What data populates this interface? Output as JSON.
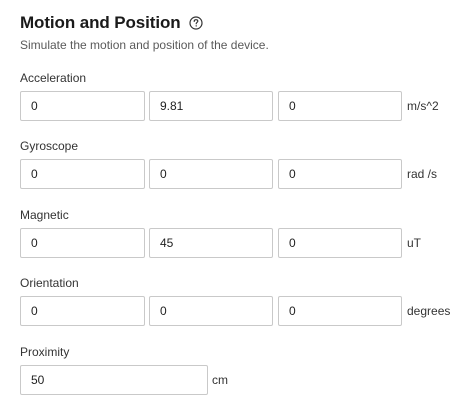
{
  "header": {
    "title": "Motion and Position",
    "subtitle": "Simulate the motion and position of the device."
  },
  "icons": {
    "help": "help-circle-icon"
  },
  "sections": [
    {
      "label": "Acceleration",
      "values": [
        "0",
        "9.81",
        "0"
      ],
      "unit": "m/s^2"
    },
    {
      "label": "Gyroscope",
      "values": [
        "0",
        "0",
        "0"
      ],
      "unit": "rad /s"
    },
    {
      "label": "Magnetic",
      "values": [
        "0",
        "45",
        "0"
      ],
      "unit": "uT"
    },
    {
      "label": "Orientation",
      "values": [
        "0",
        "0",
        "0"
      ],
      "unit": "degrees"
    },
    {
      "label": "Proximity",
      "values": [
        "50"
      ],
      "unit": "cm"
    }
  ]
}
